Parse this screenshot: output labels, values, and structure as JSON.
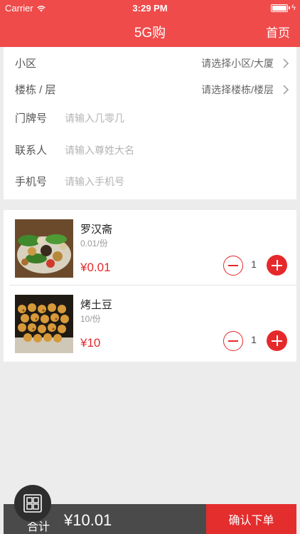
{
  "status_bar": {
    "carrier": "Carrier",
    "time": "3:29 PM"
  },
  "nav": {
    "title": "5G购",
    "home": "首页"
  },
  "form": {
    "community": {
      "label": "小区",
      "value": "请选择小区/大厦"
    },
    "building": {
      "label": "楼栋 / 层",
      "value": "请选择楼栋/楼层"
    },
    "door": {
      "label": "门牌号",
      "placeholder": "请输入几零几"
    },
    "contact": {
      "label": "联系人",
      "placeholder": "请输入尊姓大名"
    },
    "phone": {
      "label": "手机号",
      "placeholder": "请输入手机号"
    }
  },
  "products": [
    {
      "name": "罗汉斋",
      "unit": "0.01/份",
      "price": "¥0.01",
      "qty": "1"
    },
    {
      "name": "烤土豆",
      "unit": "10/份",
      "price": "¥10",
      "qty": "1"
    }
  ],
  "footer": {
    "total_label": "合计",
    "total": "¥10.01",
    "submit": "确认下单"
  },
  "colors": {
    "accent": "#ef4b4b",
    "price": "#e5292b",
    "footer_dark": "#4a4a4a",
    "submit": "#e42d2d"
  },
  "icons": [
    "wifi-icon",
    "battery-icon",
    "chevron-right-icon",
    "minus-icon",
    "plus-icon",
    "cart-grid-icon"
  ]
}
